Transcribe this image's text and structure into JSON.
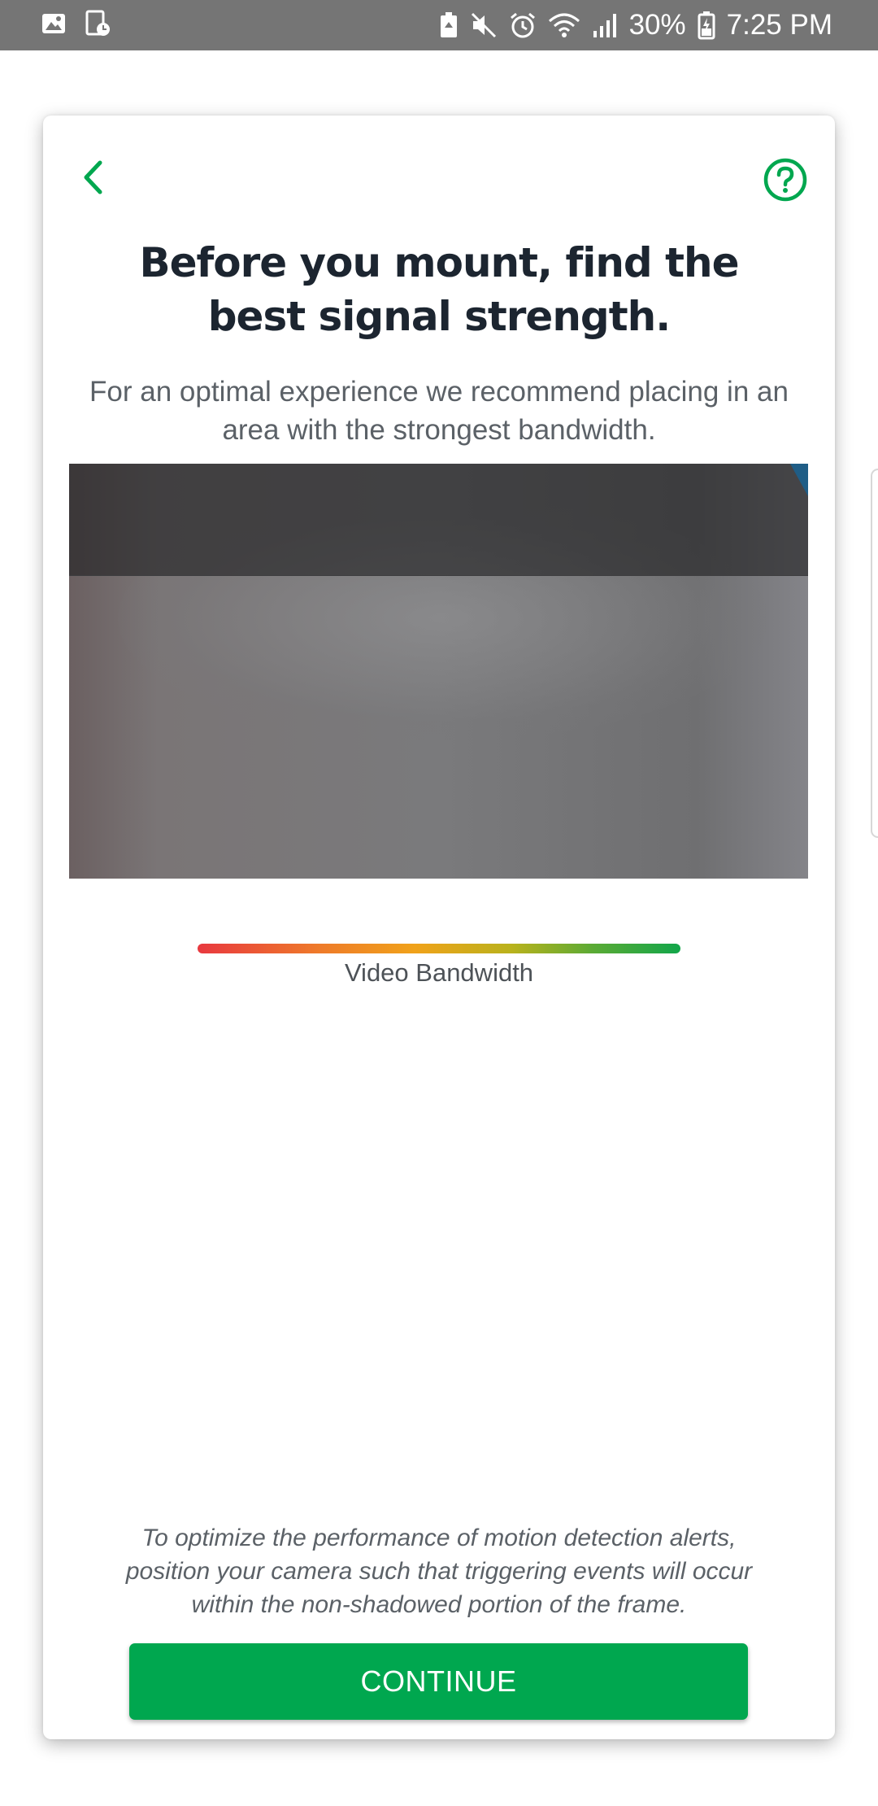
{
  "status_bar": {
    "battery_percent": "30%",
    "time": "7:25 PM",
    "icons": [
      "image-icon",
      "screenshot-icon",
      "battery-saver-icon",
      "mute-icon",
      "alarm-icon",
      "wifi-icon",
      "signal-icon",
      "battery-icon"
    ]
  },
  "header": {
    "back_icon": "chevron-left-icon",
    "help_icon": "help-circle-icon"
  },
  "content": {
    "title": "Before you mount, find the best signal strength.",
    "subtitle": "For an optimal experience we recommend placing in an area with the strongest bandwidth."
  },
  "bandwidth": {
    "label": "Video Bandwidth"
  },
  "footer": {
    "hint": "To optimize the performance of motion detection alerts, position your camera such that triggering events will occur within the non-shadowed portion of the frame.",
    "continue_label": "CONTINUE"
  },
  "colors": {
    "accent": "#00a74f",
    "title": "#1c2530",
    "body_text": "#5b6167",
    "status_bar": "#757575"
  }
}
